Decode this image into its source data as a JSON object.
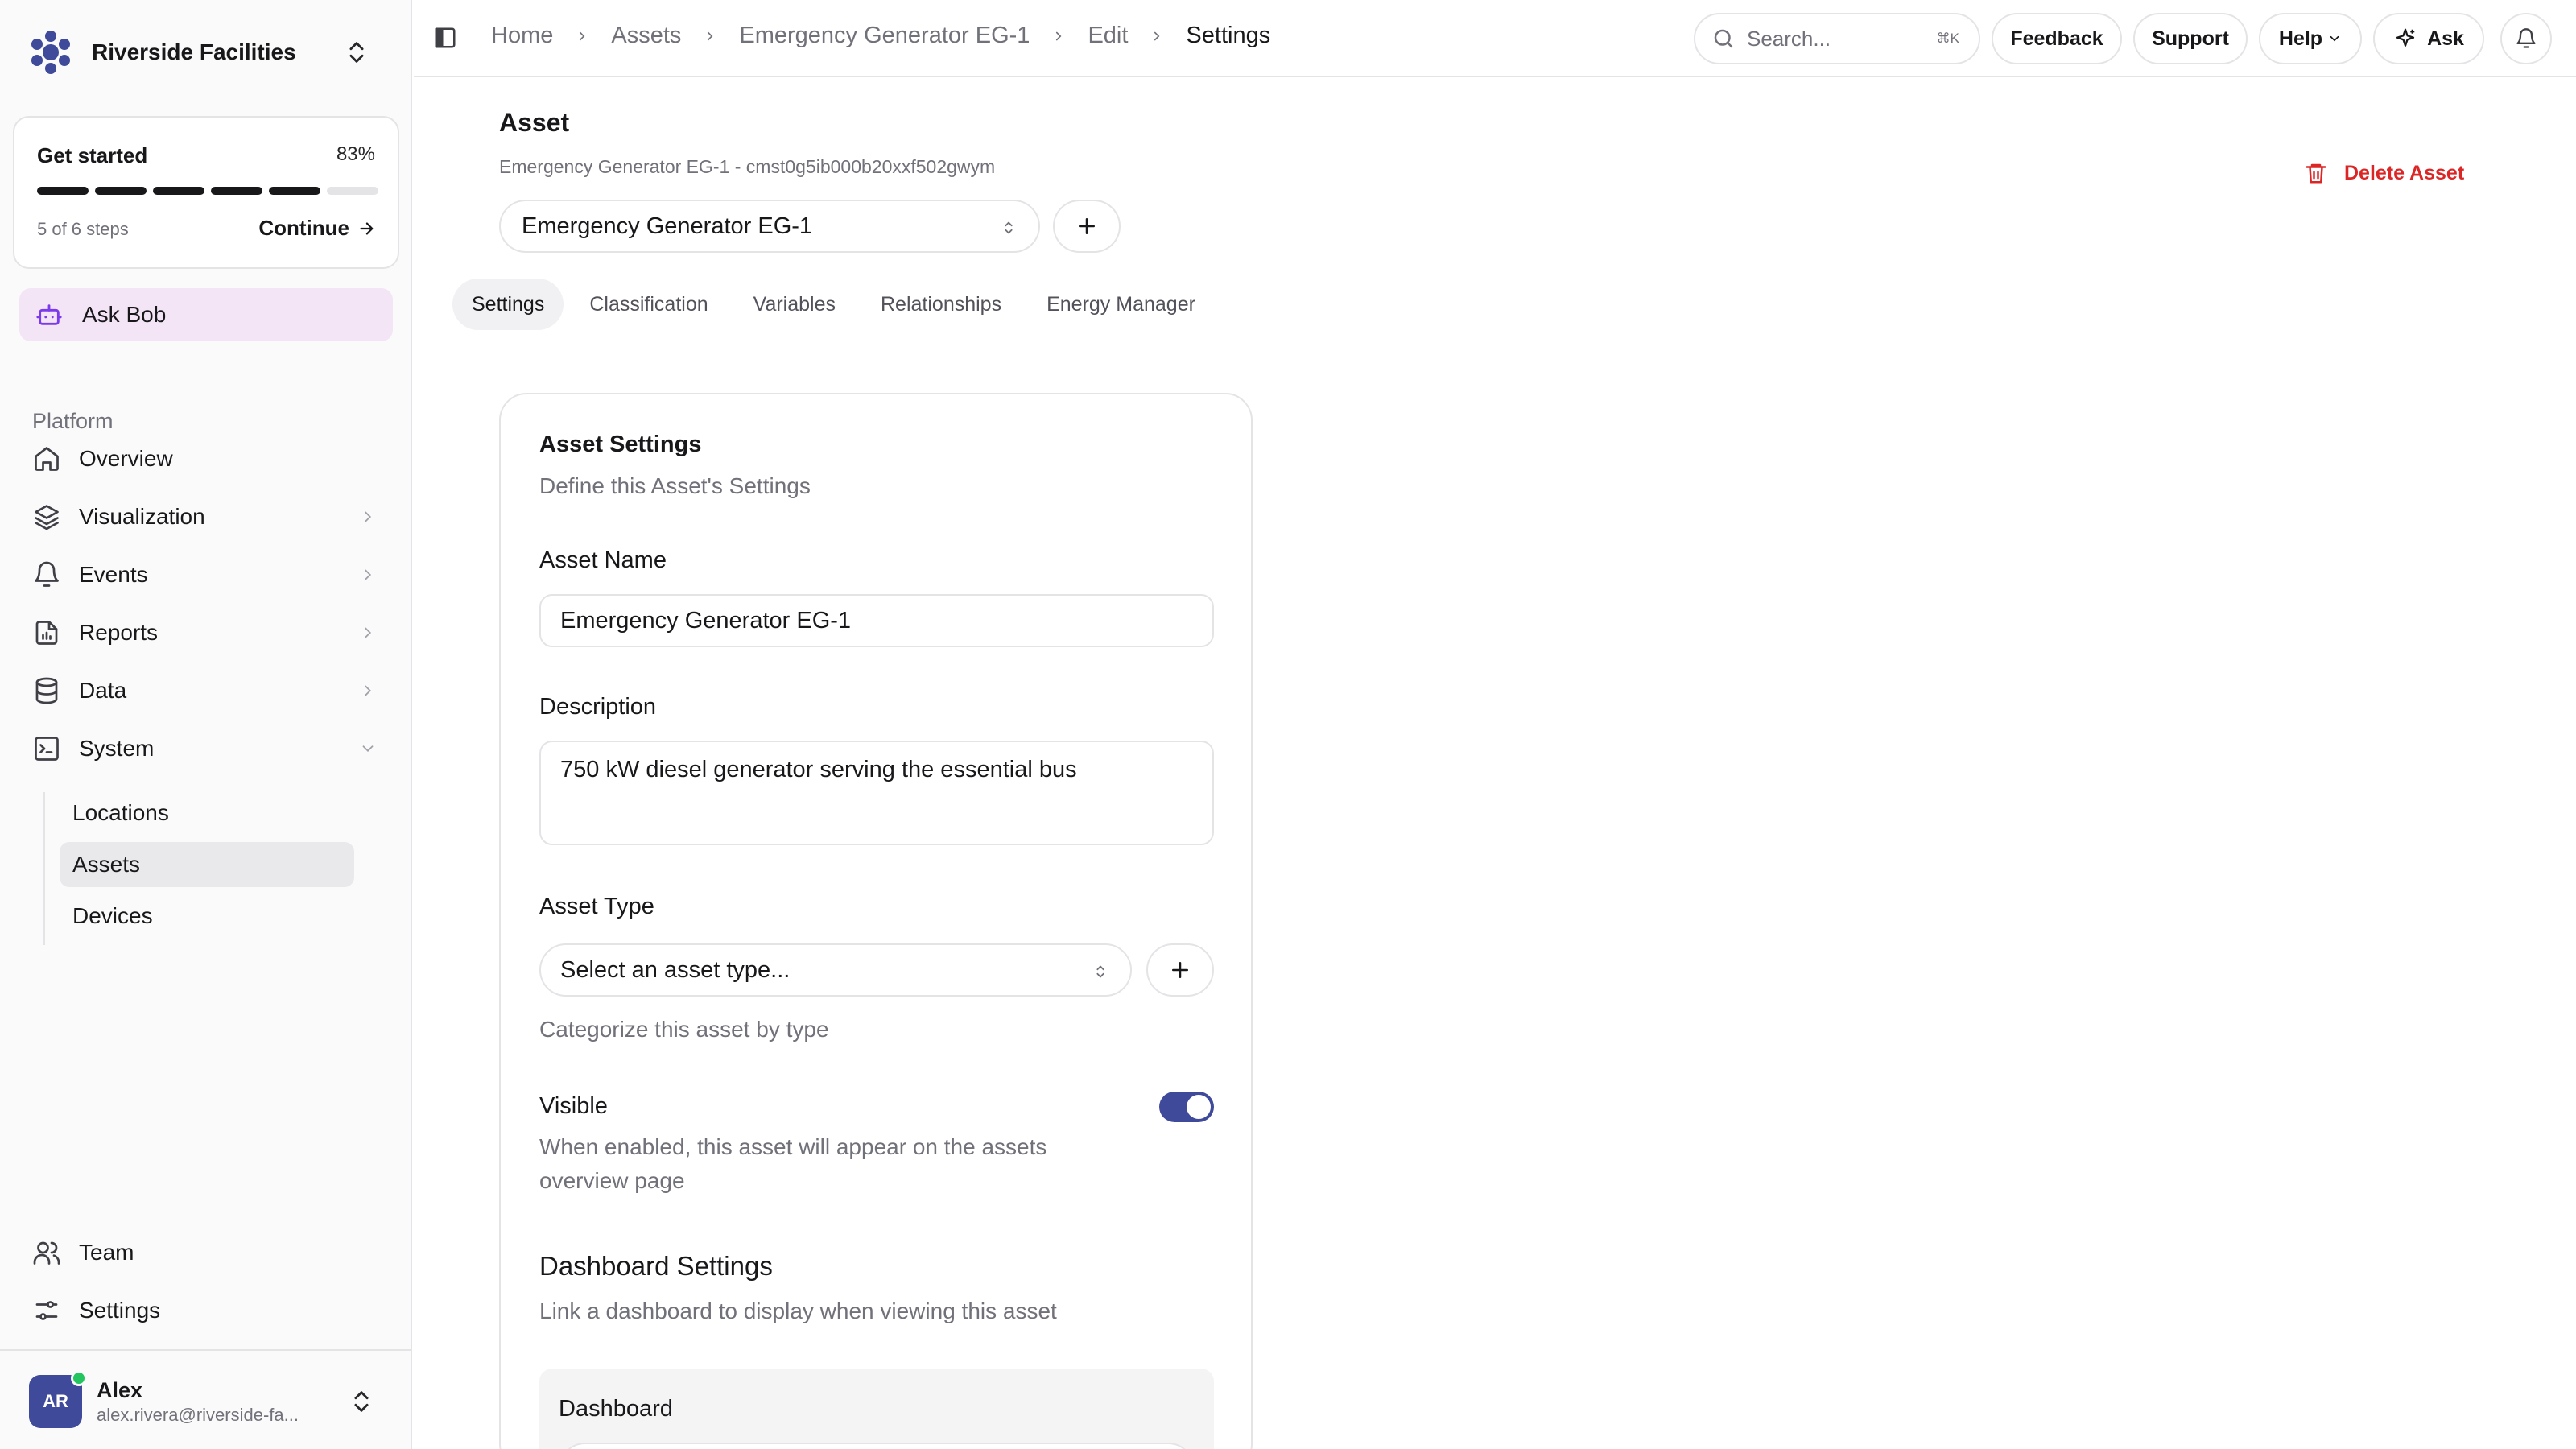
{
  "sidebar": {
    "org_name": "Riverside Facilities",
    "get_started": {
      "title": "Get started",
      "percent": "83%",
      "steps_text": "5 of 6 steps",
      "continue_label": "Continue",
      "completed_steps": 5,
      "total_steps": 6
    },
    "ask_bob": "Ask Bob",
    "section_label": "Platform",
    "nav": {
      "overview": "Overview",
      "visualization": "Visualization",
      "events": "Events",
      "reports": "Reports",
      "data": "Data",
      "system": "System",
      "team": "Team",
      "settings": "Settings"
    },
    "system_items": [
      "Locations",
      "Assets",
      "Devices"
    ],
    "user": {
      "initials": "AR",
      "name": "Alex",
      "email": "alex.rivera@riverside-fa..."
    }
  },
  "topbar": {
    "breadcrumbs": [
      "Home",
      "Assets",
      "Emergency Generator EG-1",
      "Edit",
      "Settings"
    ],
    "search_placeholder": "Search...",
    "search_shortcut": "⌘K",
    "feedback": "Feedback",
    "support": "Support",
    "help": "Help",
    "ask": "Ask"
  },
  "main": {
    "title": "Asset",
    "subtitle": "Emergency Generator EG-1 - cmst0g5ib000b20xxf502gwym",
    "delete_label": "Delete Asset",
    "selected_asset": "Emergency Generator EG-1",
    "tabs": [
      "Settings",
      "Classification",
      "Variables",
      "Relationships",
      "Energy Manager"
    ],
    "active_tab": "Settings",
    "card": {
      "title": "Asset Settings",
      "description": "Define this Asset's Settings",
      "asset_name_label": "Asset Name",
      "asset_name_value": "Emergency Generator EG-1",
      "description_label": "Description",
      "description_value": "750 kW diesel generator serving the essential bus",
      "asset_type_label": "Asset Type",
      "asset_type_placeholder": "Select an asset type...",
      "asset_type_help": "Categorize this asset by type",
      "visible_label": "Visible",
      "visible_help": "When enabled, this asset will appear on the assets overview page",
      "visible_enabled": true,
      "dashboard_section_title": "Dashboard Settings",
      "dashboard_section_desc": "Link a dashboard to display when viewing this asset",
      "dashboard_label": "Dashboard"
    }
  },
  "colors": {
    "accent": "#3f4a9a",
    "ask_bob_bg": "#f3e5f5",
    "danger": "#dc2626",
    "online": "#22c55e"
  }
}
